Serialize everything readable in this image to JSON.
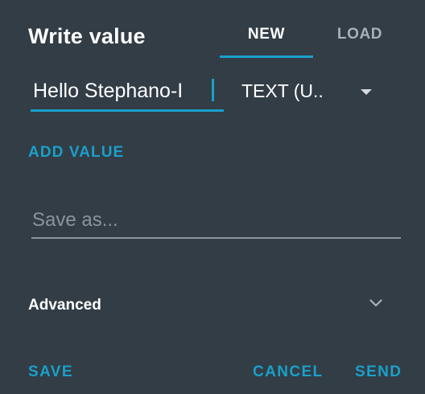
{
  "dialog": {
    "title": "Write value",
    "tabs": [
      {
        "label": "NEW",
        "active": true
      },
      {
        "label": "LOAD",
        "active": false
      }
    ],
    "value_field": {
      "value": "Hello Stephano-I"
    },
    "type_select": {
      "selected": "TEXT (U.."
    },
    "add_value_label": "ADD VALUE",
    "save_as": {
      "placeholder": "Save as..."
    },
    "advanced": {
      "label": "Advanced",
      "icon": "chevron-down-icon"
    },
    "actions": {
      "save": "SAVE",
      "cancel": "CANCEL",
      "send": "SEND"
    }
  },
  "colors": {
    "background": "#323d46",
    "accent": "#1aa0c9",
    "text": "#ffffff",
    "muted": "#a9b0b6",
    "placeholder": "#8c949a"
  }
}
